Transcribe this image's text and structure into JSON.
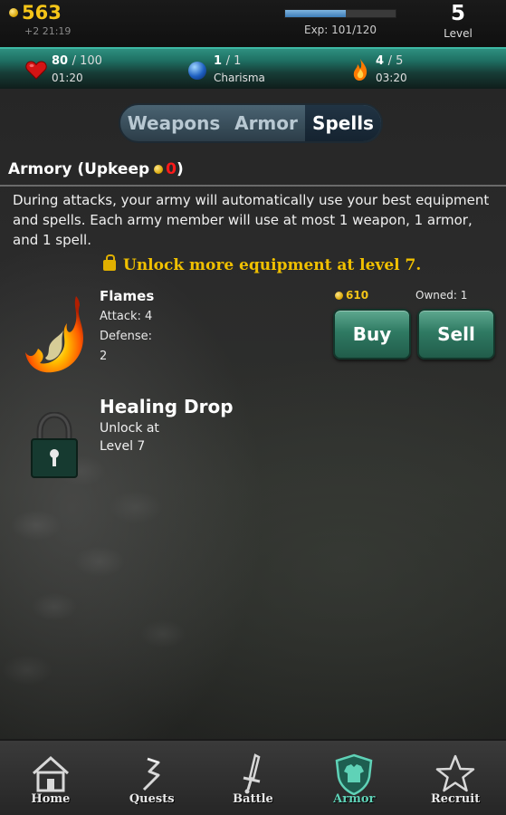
{
  "top": {
    "gold": "563",
    "gold_timer": "+2 21:19",
    "exp_text": "Exp: 101/120",
    "exp_progress": 0.55,
    "level": "5",
    "level_label": "Level"
  },
  "stats": {
    "health": {
      "current": "80",
      "max": "/ 100",
      "timer": "01:20",
      "icon": "heart-icon"
    },
    "charisma": {
      "current": "1",
      "max": "/ 1",
      "label": "Charisma",
      "icon": "orb-icon"
    },
    "energy": {
      "current": "4",
      "max": "/ 5",
      "timer": "03:20",
      "icon": "flame-icon"
    }
  },
  "tabs": [
    {
      "label": "Weapons",
      "active": false
    },
    {
      "label": "Armor",
      "active": false
    },
    {
      "label": "Spells",
      "active": true
    }
  ],
  "armory": {
    "title": "Armory (Upkeep",
    "upkeep": "0",
    "close_paren": ")",
    "description": "During attacks, your army will automatically use your best equipment and spells. Each army member will use at most 1 weapon, 1 armor, and 1 spell.",
    "unlock_note": "Unlock more equipment at level 7."
  },
  "items": [
    {
      "name": "Flames",
      "attack": "Attack: 4",
      "defense_label": "Defense:",
      "defense_value": "2",
      "price": "610",
      "owned": "Owned: 1",
      "buy_label": "Buy",
      "sell_label": "Sell"
    },
    {
      "name": "Healing Drop",
      "unlock_line1": "Unlock at",
      "unlock_line2": "Level 7"
    }
  ],
  "nav": [
    {
      "label": "Home",
      "icon": "house-icon",
      "active": false
    },
    {
      "label": "Quests",
      "icon": "quest-icon",
      "active": false
    },
    {
      "label": "Battle",
      "icon": "sword-icon",
      "active": false
    },
    {
      "label": "Armor",
      "icon": "shield-shirt-icon",
      "active": true
    },
    {
      "label": "Recruit",
      "icon": "star-icon",
      "active": false
    }
  ],
  "colors": {
    "gold": "#f5c518",
    "accent_teal": "#2e8f7f",
    "upkeep_red": "#ff1a1a",
    "button_green": "#2f7a63",
    "unlock_yellow": "#f0c000"
  }
}
